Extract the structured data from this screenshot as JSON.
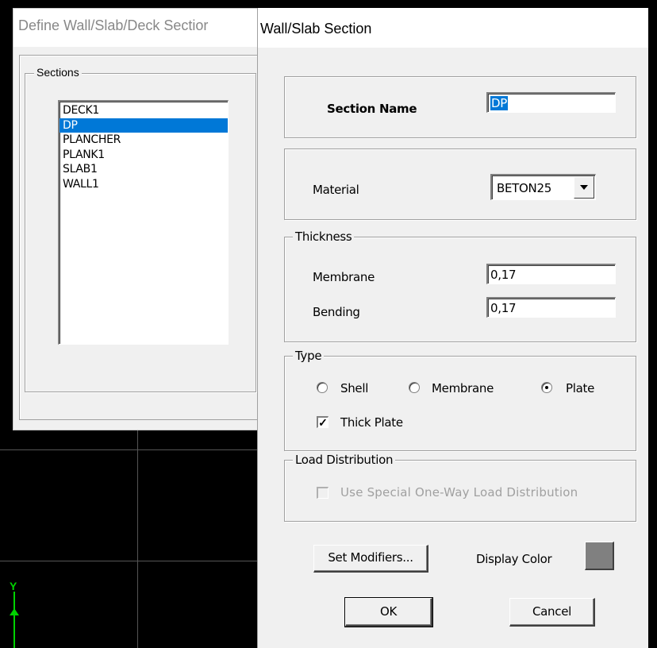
{
  "background_dialog": {
    "title": "Define Wall/Slab/Deck Sectior",
    "sections_label": "Sections",
    "sections": [
      {
        "name": "DECK1",
        "selected": false
      },
      {
        "name": "DP",
        "selected": true
      },
      {
        "name": "PLANCHER",
        "selected": false
      },
      {
        "name": "PLANK1",
        "selected": false
      },
      {
        "name": "SLAB1",
        "selected": false
      },
      {
        "name": "WALL1",
        "selected": false
      }
    ]
  },
  "viewport": {
    "axis_label": "Y",
    "axis_color": "#00d200"
  },
  "dialog": {
    "title": "Wall/Slab Section",
    "section_name_label": "Section Name",
    "section_name_value": "DP",
    "material_label": "Material",
    "material_value": "BETON25",
    "thickness_legend": "Thickness",
    "membrane_label": "Membrane",
    "membrane_value": "0,17",
    "bending_label": "Bending",
    "bending_value": "0,17",
    "type_legend": "Type",
    "type_options": [
      {
        "label": "Shell",
        "checked": false
      },
      {
        "label": "Membrane",
        "checked": false
      },
      {
        "label": "Plate",
        "checked": true
      }
    ],
    "thick_plate_label": "Thick Plate",
    "thick_plate_checked": true,
    "load_distribution_legend": "Load Distribution",
    "one_way_label": "Use Special One-Way Load Distribution",
    "one_way_checked": false,
    "set_modifiers_label": "Set Modifiers...",
    "display_color_label": "Display Color",
    "display_color": "#808080",
    "ok_label": "OK",
    "cancel_label": "Cancel",
    "selection_color": "#0078d7"
  }
}
